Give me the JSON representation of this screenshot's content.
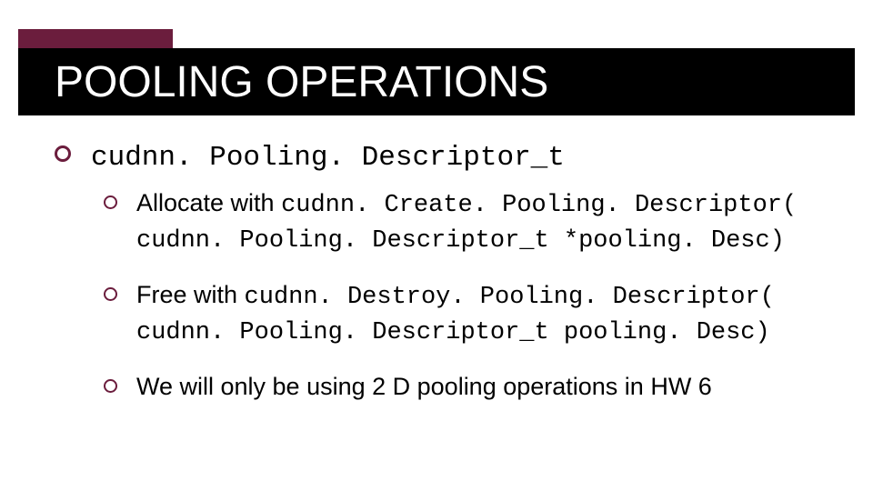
{
  "colors": {
    "accent": "#6b1d3d",
    "titlebar_bg": "#000000",
    "title_fg": "#ffffff"
  },
  "title": "POOLING OPERATIONS",
  "bullets": {
    "level1": {
      "item0": {
        "code": "cudnn. Pooling. Descriptor_t"
      }
    },
    "level2": {
      "item0": {
        "prefix": "Allocate with ",
        "code": "cudnn. Create. Pooling. Descriptor( cudnn. Pooling. Descriptor_t *pooling. Desc)"
      },
      "item1": {
        "prefix": "Free with ",
        "code": "cudnn. Destroy. Pooling. Descriptor( cudnn. Pooling. Descriptor_t pooling. Desc)"
      },
      "item2": {
        "text": "We will only be using 2 D pooling operations in HW 6"
      }
    }
  }
}
